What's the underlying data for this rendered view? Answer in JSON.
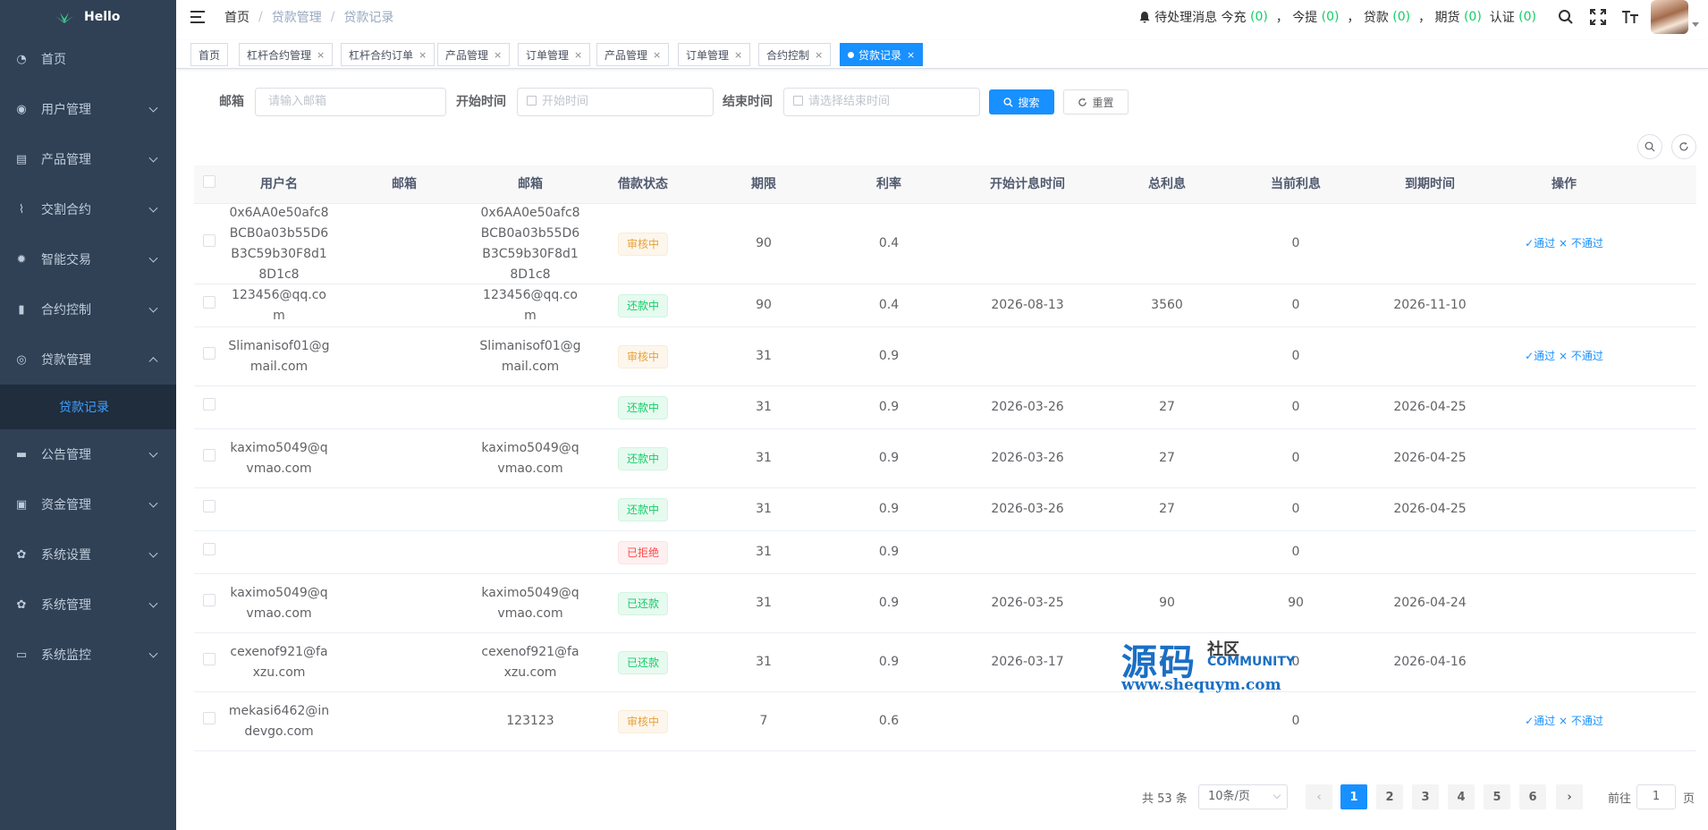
{
  "app": {
    "name": "Hello"
  },
  "sidebar": {
    "items": [
      {
        "label": "首页",
        "icon": "dashboard-icon"
      },
      {
        "label": "用户管理",
        "icon": "user-icon"
      },
      {
        "label": "产品管理",
        "icon": "document-icon"
      },
      {
        "label": "交割合约",
        "icon": "chart-line-icon"
      },
      {
        "label": "智能交易",
        "icon": "gear-icon"
      },
      {
        "label": "合约控制",
        "icon": "bar-chart-icon"
      },
      {
        "label": "贷款管理",
        "icon": "money-icon"
      },
      {
        "label": "公告管理",
        "icon": "message-icon"
      },
      {
        "label": "资金管理",
        "icon": "wallet-icon"
      },
      {
        "label": "系统设置",
        "icon": "settings-icon"
      },
      {
        "label": "系统管理",
        "icon": "settings-icon"
      },
      {
        "label": "系统监控",
        "icon": "monitor-icon"
      }
    ],
    "active_sub": "贷款记录"
  },
  "navbar": {
    "breadcrumb": [
      "首页",
      "贷款管理",
      "贷款记录"
    ],
    "notice_prefix": "待处理消息 今充",
    "today_recharge": "(0)",
    "sep1": "，",
    "today_withdraw_label": "今提",
    "today_withdraw": "(0)",
    "sep2": "，",
    "loan_label": "贷款",
    "loan": "(0)",
    "sep3": "，",
    "futures_label": "期货",
    "futures": "(0)",
    "sep4": "，",
    "auth_label": "认证",
    "auth": "(0)"
  },
  "tags": [
    {
      "label": "首页",
      "closable": false
    },
    {
      "label": "杠杆合约管理",
      "closable": true
    },
    {
      "label": "杠杆合约订单",
      "closable": true
    },
    {
      "label": "产品管理",
      "closable": true
    },
    {
      "label": "订单管理",
      "closable": true
    },
    {
      "label": "产品管理",
      "closable": true
    },
    {
      "label": "订单管理",
      "closable": true
    },
    {
      "label": "合约控制",
      "closable": true
    },
    {
      "label": "贷款记录",
      "closable": true,
      "active": true
    }
  ],
  "filters": {
    "email_label": "邮箱",
    "email_placeholder": "请输入邮箱",
    "start_label": "开始时间",
    "start_placeholder": "开始时间",
    "end_label": "结束时间",
    "end_placeholder": "请选择结束时间",
    "search_button": "搜索",
    "reset_button": "重置"
  },
  "table": {
    "columns": [
      "用户名",
      "邮箱",
      "邮箱",
      "借款状态",
      "期限",
      "利率",
      "开始计息时间",
      "总利息",
      "当前利息",
      "到期时间",
      "操作"
    ],
    "rows": [
      {
        "username": "0x6AA0e50afc8BCB0a03b55D6B3C59b30F8d18D1c8",
        "email1": "",
        "email2": "0x6AA0e50afc8BCB0a03b55D6B3C59b30F8d18D1c8",
        "status": "审核中",
        "status_type": "warn",
        "term": "90",
        "rate": "0.4",
        "start": "",
        "total": "",
        "current": "0",
        "due": "",
        "ops": true
      },
      {
        "username": "123456@qq.com",
        "email1": "",
        "email2": "123456@qq.com",
        "status": "还款中",
        "status_type": "ok",
        "term": "90",
        "rate": "0.4",
        "start": "2026-08-13",
        "total": "3560",
        "current": "0",
        "due": "2026-11-10",
        "ops": false
      },
      {
        "username": "Slimanisof01@gmail.com",
        "email1": "",
        "email2": "Slimanisof01@gmail.com",
        "status": "审核中",
        "status_type": "warn",
        "term": "31",
        "rate": "0.9",
        "start": "",
        "total": "",
        "current": "0",
        "due": "",
        "ops": true
      },
      {
        "username": "",
        "email1": "",
        "email2": "",
        "status": "还款中",
        "status_type": "ok",
        "term": "31",
        "rate": "0.9",
        "start": "2026-03-26",
        "total": "27",
        "current": "0",
        "due": "2026-04-25",
        "ops": false
      },
      {
        "username": "kaximo5049@qvmao.com",
        "email1": "",
        "email2": "kaximo5049@qvmao.com",
        "status": "还款中",
        "status_type": "ok",
        "term": "31",
        "rate": "0.9",
        "start": "2026-03-26",
        "total": "27",
        "current": "0",
        "due": "2026-04-25",
        "ops": false
      },
      {
        "username": "",
        "email1": "",
        "email2": "",
        "status": "还款中",
        "status_type": "ok",
        "term": "31",
        "rate": "0.9",
        "start": "2026-03-26",
        "total": "27",
        "current": "0",
        "due": "2026-04-25",
        "ops": false
      },
      {
        "username": "",
        "email1": "",
        "email2": "",
        "status": "已拒绝",
        "status_type": "danger",
        "term": "31",
        "rate": "0.9",
        "start": "",
        "total": "",
        "current": "0",
        "due": "",
        "ops": false
      },
      {
        "username": "kaximo5049@qvmao.com",
        "email1": "",
        "email2": "kaximo5049@qvmao.com",
        "status": "已还款",
        "status_type": "ok",
        "term": "31",
        "rate": "0.9",
        "start": "2026-03-25",
        "total": "90",
        "current": "90",
        "due": "2026-04-24",
        "ops": false
      },
      {
        "username": "cexenof921@faxzu.com",
        "email1": "",
        "email2": "cexenof921@faxzu.com",
        "status": "已还款",
        "status_type": "ok",
        "term": "31",
        "rate": "0.9",
        "start": "2026-03-17",
        "total": "27",
        "current": "0",
        "due": "2026-04-16",
        "ops": false
      },
      {
        "username": "mekasi6462@indevgo.com",
        "email1": "",
        "email2": "123123",
        "status": "审核中",
        "status_type": "warn",
        "term": "7",
        "rate": "0.6",
        "start": "",
        "total": "",
        "current": "0",
        "due": "",
        "ops": true
      }
    ],
    "approve": "✓通过",
    "reject": "× 不通过"
  },
  "pagination": {
    "total_text": "共 53 条",
    "page_size": "10条/页",
    "pages": [
      "1",
      "2",
      "3",
      "4",
      "5",
      "6"
    ],
    "current": "1",
    "goto_label": "前往",
    "goto_value": "1",
    "page_suffix": "页"
  },
  "watermark": {
    "big": "源码",
    "small": "社区",
    "community": "COMMUNITY",
    "url": "www.shequym.com"
  }
}
